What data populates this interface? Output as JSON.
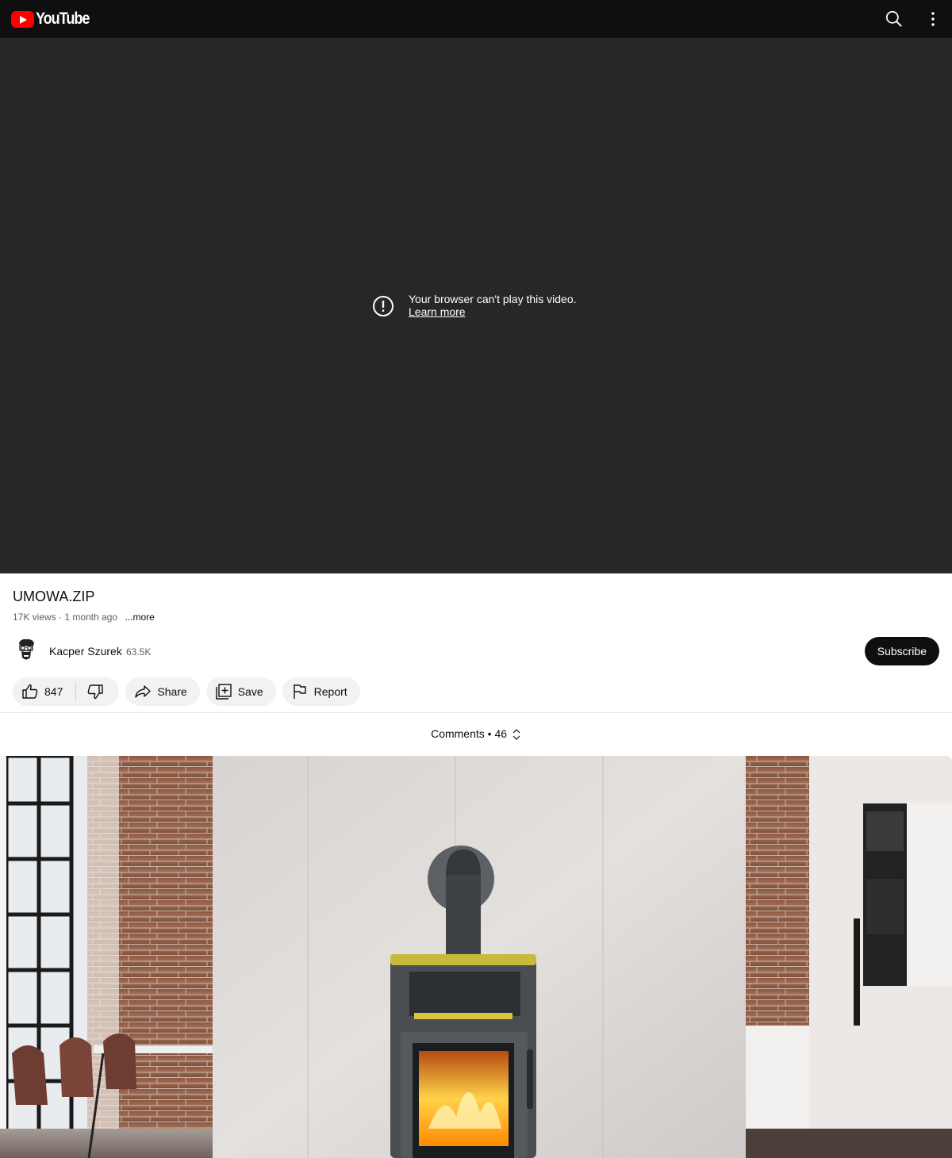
{
  "header": {
    "logo_text": "YouTube",
    "icons": [
      "search-icon",
      "more-vert-icon"
    ]
  },
  "player": {
    "error_message": "Your browser can't play this video.",
    "learn_more": "Learn more"
  },
  "video": {
    "title": "UMOWA.ZIP",
    "views": "17K views",
    "separator": "·",
    "age": "1 month ago",
    "more": "...more"
  },
  "channel": {
    "name": "Kacper Szurek",
    "subscribers": "63.5K",
    "subscribe_label": "Subscribe"
  },
  "actions": {
    "likes": "847",
    "share": "Share",
    "save": "Save",
    "report": "Report"
  },
  "comments": {
    "label": "Comments",
    "bullet": "•",
    "count": "46"
  },
  "colors": {
    "brand_red": "#ff0000",
    "header_bg": "#0f0f0f",
    "player_bg": "#272727",
    "pill_bg": "#f2f2f2"
  }
}
